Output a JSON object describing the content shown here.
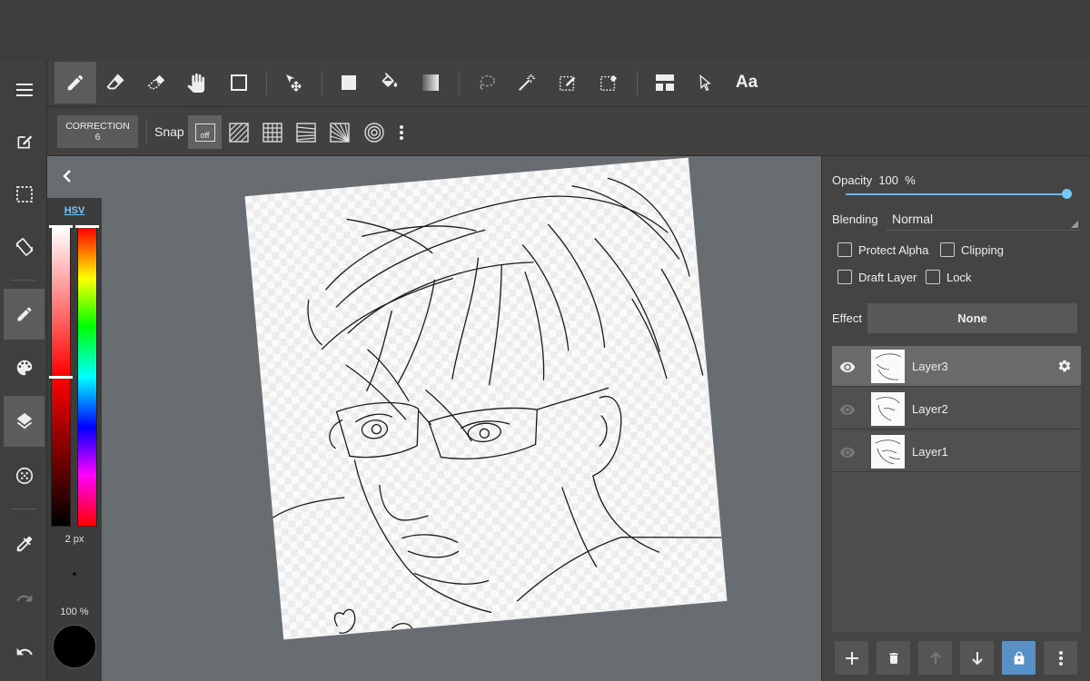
{
  "toolbar": {
    "tools": [
      "pen-tool",
      "eraser-tool",
      "selection-eraser-tool",
      "hand-tool",
      "shape-tool",
      "move-tool",
      "fill-color-tool",
      "bucket-tool",
      "gradient-tool",
      "lasso-tool",
      "magic-wand-tool",
      "select-pen-tool",
      "select-eraser-tool",
      "frame-divider-tool",
      "operation-tool"
    ],
    "text_tool_label": "Aa"
  },
  "subbar": {
    "correction_label": "CORRECTION",
    "correction_value": "6",
    "snap_label": "Snap",
    "snap_off_label": "off"
  },
  "sidebar": {
    "items": [
      "menu-icon",
      "edit-canvas-icon",
      "selection-icon",
      "rotate-canvas-icon",
      "brush-icon",
      "palette-icon",
      "layers-icon",
      "material-icon",
      "eyedropper-icon",
      "redo-icon",
      "undo-icon"
    ]
  },
  "color_panel": {
    "mode_label": "HSV",
    "brush_size": "2 px",
    "brush_opacity": "100 %",
    "current_color": "#000000"
  },
  "layer_panel": {
    "opacity_label": "Opacity",
    "opacity_value": "100",
    "opacity_unit": "%",
    "opacity_fraction": 1.0,
    "blending_label": "Blending",
    "blending_value": "Normal",
    "protect_alpha_label": "Protect Alpha",
    "clipping_label": "Clipping",
    "draft_layer_label": "Draft Layer",
    "lock_label": "Lock",
    "effect_label": "Effect",
    "effect_value": "None",
    "layers": [
      {
        "name": "Layer3",
        "selected": true
      },
      {
        "name": "Layer2",
        "selected": false
      },
      {
        "name": "Layer1",
        "selected": false
      }
    ]
  },
  "colors": {
    "accent": "#6ab9ee",
    "lock_active": "#5891c8"
  }
}
